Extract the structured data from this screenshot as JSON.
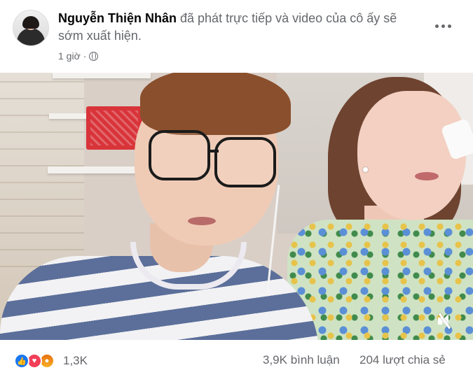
{
  "post": {
    "author": "Nguyễn Thiện Nhân",
    "action_text": " đã phát trực tiếp và video của cô ấy sẽ sớm xuất hiện.",
    "time": "1 giờ",
    "more_icon": "more-horizontal-icon",
    "privacy_icon": "globe-icon"
  },
  "video": {
    "mute_icon": "speaker-muted-icon"
  },
  "footer": {
    "reactions": [
      "like-icon",
      "love-icon",
      "angry-icon"
    ],
    "reaction_count": "1,3K",
    "comments": "3,9K bình luận",
    "shares": "204 lượt chia sẻ"
  },
  "colors": {
    "like": "#1877f2",
    "love": "#f33e58",
    "secondary_text": "#65676b"
  }
}
